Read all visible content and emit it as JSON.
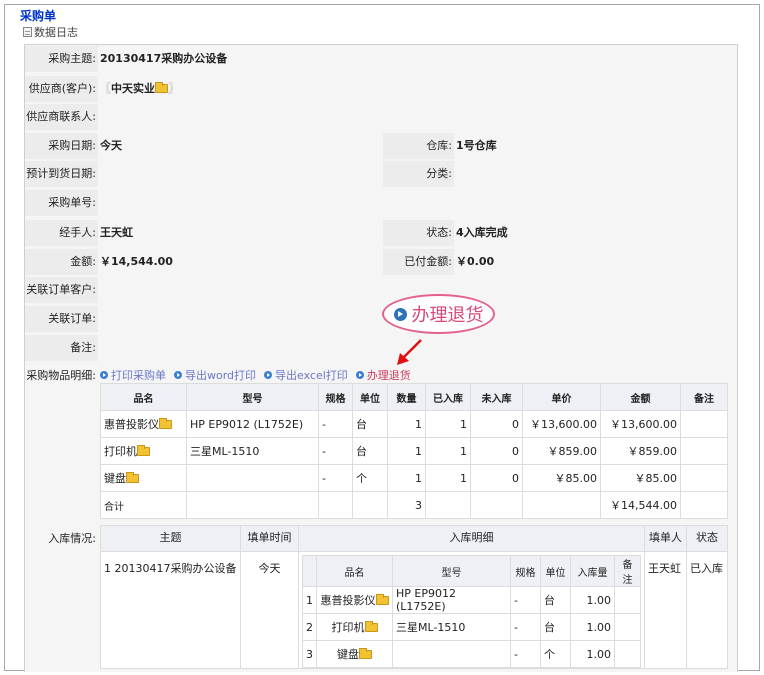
{
  "page": {
    "title": "采购单",
    "datalog": "数据日志"
  },
  "fields": {
    "subject": {
      "label": "采购主题:",
      "value": "20130417采购办公设备"
    },
    "supplier": {
      "label": "供应商(客户):",
      "value": "中天实业"
    },
    "contact": {
      "label": "供应商联系人:",
      "value": ""
    },
    "date": {
      "label": "采购日期:",
      "value": "今天"
    },
    "warehouse": {
      "label": "仓库:",
      "value": "1号仓库"
    },
    "expected": {
      "label": "预计到货日期:",
      "value": ""
    },
    "category": {
      "label": "分类:",
      "value": ""
    },
    "order_no": {
      "label": "采购单号:",
      "value": ""
    },
    "handler": {
      "label": "经手人:",
      "value": "王天虹"
    },
    "status": {
      "label": "状态:",
      "value": "4入库完成"
    },
    "amount": {
      "label": "金额:",
      "value": "￥14,544.00"
    },
    "paid": {
      "label": "已付金额:",
      "value": "￥0.00"
    },
    "linked_customer": {
      "label": "关联订单客户:",
      "value": ""
    },
    "linked_order": {
      "label": "关联订单:",
      "value": ""
    },
    "remark": {
      "label": "备注:",
      "value": ""
    },
    "items_label": {
      "label": "采购物品明细:"
    },
    "stock_label": {
      "label": "入库情况:"
    }
  },
  "return_button": {
    "label": "办理退货"
  },
  "actions": {
    "print": "打印采购单",
    "word": "导出word打印",
    "excel": "导出excel打印",
    "return": "办理退货"
  },
  "items": {
    "headers": {
      "name": "品名",
      "model": "型号",
      "spec": "规格",
      "unit": "单位",
      "qty": "数量",
      "in": "已入库",
      "notin": "未入库",
      "price": "单价",
      "total": "金额",
      "note": "备注"
    },
    "rows": [
      {
        "name": "惠普投影仪",
        "model": "HP EP9012 (L1752E)",
        "spec": "-",
        "unit": "台",
        "qty": "1",
        "in": "1",
        "notin": "0",
        "price": "￥13,600.00",
        "total": "￥13,600.00"
      },
      {
        "name": "打印机",
        "model": "三星ML-1510",
        "spec": "-",
        "unit": "台",
        "qty": "1",
        "in": "1",
        "notin": "0",
        "price": "￥859.00",
        "total": "￥859.00"
      },
      {
        "name": "键盘",
        "model": "",
        "spec": "-",
        "unit": "个",
        "qty": "1",
        "in": "1",
        "notin": "0",
        "price": "￥85.00",
        "total": "￥85.00"
      }
    ],
    "sum": {
      "label": "合计",
      "qty": "3",
      "total": "￥14,544.00"
    }
  },
  "stock": {
    "headers": {
      "subject": "主题",
      "time": "填单时间",
      "detail": "入库明细",
      "filler": "填单人",
      "status": "状态"
    },
    "row": {
      "index": "1",
      "subject": "20130417采购办公设备",
      "time": "今天",
      "filler": "王天虹",
      "status": "已入库"
    },
    "detail_headers": {
      "name": "品名",
      "model": "型号",
      "spec": "规格",
      "unit": "单位",
      "qty": "入库量",
      "note": "备注"
    },
    "details": [
      {
        "index": "1",
        "name": "惠普投影仪",
        "model": "HP EP9012 (L1752E)",
        "spec": "-",
        "unit": "台",
        "qty": "1.00"
      },
      {
        "index": "2",
        "name": "打印机",
        "model": "三星ML-1510",
        "spec": "-",
        "unit": "台",
        "qty": "1.00"
      },
      {
        "index": "3",
        "name": "键盘",
        "model": "",
        "spec": "-",
        "unit": "个",
        "qty": "1.00"
      }
    ]
  }
}
